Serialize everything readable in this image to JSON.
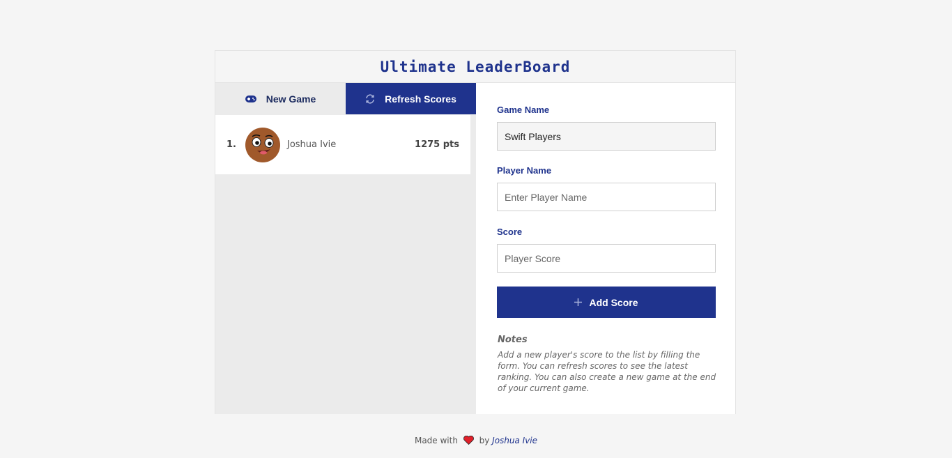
{
  "header": {
    "title": "Ultimate LeaderBoard"
  },
  "tabs": {
    "new_game": {
      "label": "New Game",
      "icon": "gamepad-icon"
    },
    "refresh": {
      "label": "Refresh Scores",
      "icon": "refresh-icon"
    }
  },
  "leaderboard": {
    "entries": [
      {
        "rank": "1.",
        "name": "Joshua Ivie",
        "points": "1275 pts",
        "avatar": "cartoon-face-avatar"
      }
    ]
  },
  "form": {
    "game_name": {
      "label": "Game Name",
      "value": "Swift Players"
    },
    "player_name": {
      "label": "Player Name",
      "placeholder": "Enter Player Name"
    },
    "score": {
      "label": "Score",
      "placeholder": "Player Score"
    },
    "add_button": {
      "label": "Add Score",
      "icon": "plus-icon"
    }
  },
  "notes": {
    "title": "Notes",
    "body": "Add a new player's score to the list by filling the form. You can refresh scores to see the latest ranking. You can also create a new game at the end of your current game."
  },
  "footer": {
    "made_with": "Made with",
    "by": "by",
    "author": "Joshua Ivie"
  },
  "colors": {
    "primary": "#1f338d",
    "background": "#f5f5f5",
    "panel": "#ebebeb",
    "heart": "#e0202a"
  }
}
